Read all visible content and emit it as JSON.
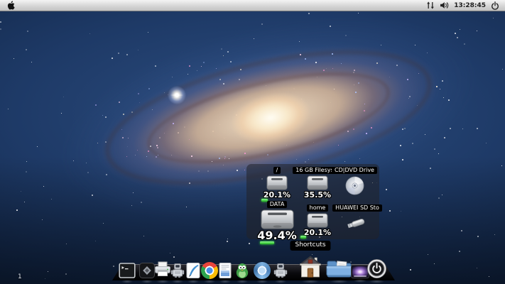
{
  "menubar": {
    "clock": "13:28:45",
    "icons": [
      "apple-menu",
      "network-traffic",
      "volume",
      "power-menu"
    ]
  },
  "desktop": {
    "workspace_label": "1"
  },
  "drives_panel": {
    "items": [
      {
        "label": "/",
        "usage": "20.1%",
        "icon": "hard-drive"
      },
      {
        "label": "16 GB Filesyste",
        "usage": "35.5%",
        "icon": "hard-drive"
      },
      {
        "label": "CD|DVD Drive",
        "icon": "optical-disc"
      },
      {
        "label": "DATA",
        "usage": "49.4%",
        "icon": "hard-drive-large"
      },
      {
        "label": "home",
        "usage": "20.1%",
        "icon": "hard-drive"
      },
      {
        "label": "HUAWEI SD Sto",
        "icon": "usb-stick"
      }
    ]
  },
  "dock": {
    "tooltip": "Shortcuts",
    "items": [
      "terminal",
      "disk-utility",
      "printer",
      "robot-utility",
      "text-editor",
      "google-chrome",
      "libreoffice-writer",
      "green-bird",
      "chromium",
      "robot-utility-2",
      "shortcuts-home",
      "documents-folder",
      "wallpaper-gallery",
      "power-button"
    ]
  },
  "colors": {
    "menubar_bg": "#d9d9d9",
    "panel_bg": "rgba(35,35,40,0.55)",
    "usage_green": "#34d23a",
    "tooltip_bg": "#000000",
    "wallpaper_base": "#1e3a67"
  }
}
